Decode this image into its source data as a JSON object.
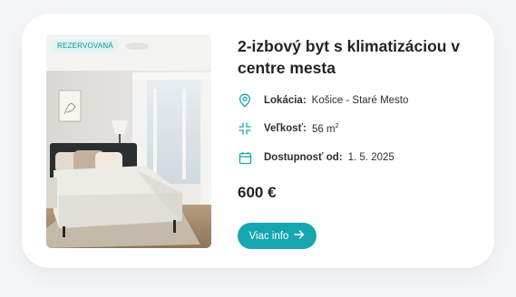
{
  "listing": {
    "badge": "REZERVOVANÁ",
    "title": "2-izbový byt s klimatizáciou v centre mesta",
    "location": {
      "label": "Lokácia:",
      "value": "Košice - Staré Mesto",
      "icon": "map-pin-icon"
    },
    "size": {
      "label": "Veľkosť:",
      "value": "56 m",
      "unit_sup": "2",
      "icon": "resize-icon"
    },
    "availability": {
      "label": "Dostupnosť od:",
      "value": "1. 5. 2025",
      "icon": "calendar-icon"
    },
    "price": "600 €",
    "button_label": "Viac info",
    "accent_color": "#16a6b0"
  }
}
